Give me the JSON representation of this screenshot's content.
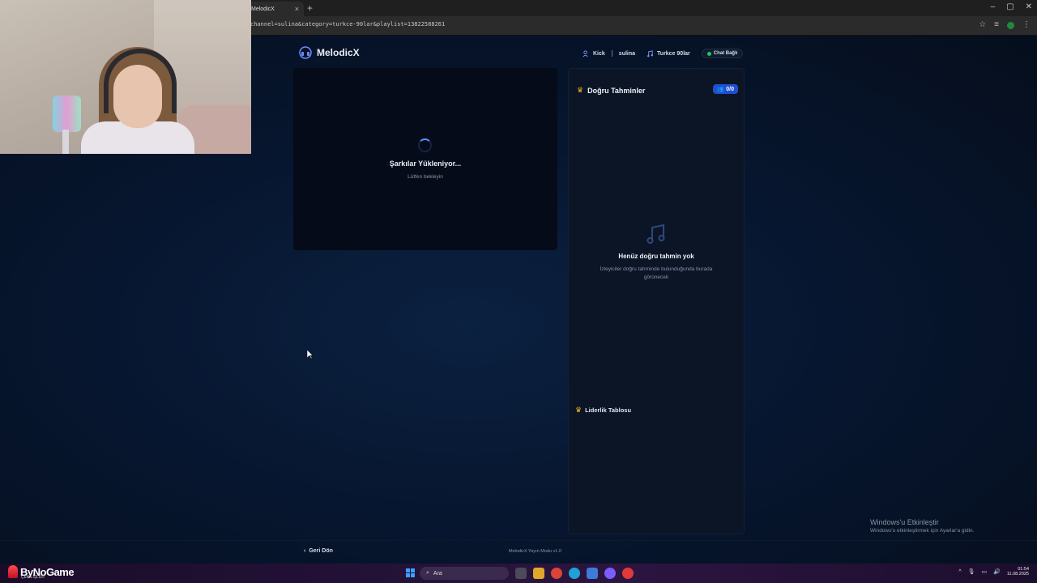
{
  "browser": {
    "tab_title": "MelodicX",
    "tab_close": "×",
    "new_tab": "+",
    "url": "channel=sulina&category=turkce-90lar&playlist=13822588261",
    "window_controls": [
      "–",
      "▢",
      "✕"
    ]
  },
  "app": {
    "logo_text": "MelodicX",
    "header": {
      "platform": "Kick",
      "channel": "sulina",
      "category": "Turkce 90lar",
      "chat_status": "Chat Bağlı"
    },
    "player": {
      "loading_title": "Şarkılar Yükleniyor...",
      "loading_sub": "Lütfen bekleyin"
    },
    "guesses": {
      "title": "Doğru Tahminler",
      "count": "0/0",
      "empty_title": "Henüz doğru tahmin yok",
      "empty_sub": "İzleyiciler doğru tahminde bulunduğunda burada görünecek"
    },
    "leaderboard": {
      "title": "Liderlik Tablosu"
    },
    "footer": {
      "back_label": "Geri Dön",
      "version": "MelodicX Yayın Modu v1.0"
    }
  },
  "windows_activation": {
    "title": "Windows'u Etkinleştir",
    "sub": "Windows'u etkinleştirmek için Ayarlar'a gidin."
  },
  "taskbar": {
    "brand": "ByNoGame",
    "brand_sub": "ÇEKİLİŞLER",
    "search_placeholder": "Ara",
    "time": "01:54",
    "date": "11.08.2025"
  },
  "colors": {
    "accent": "#1e4fd1",
    "status_ok": "#22c55e",
    "crown": "#f0b429"
  }
}
